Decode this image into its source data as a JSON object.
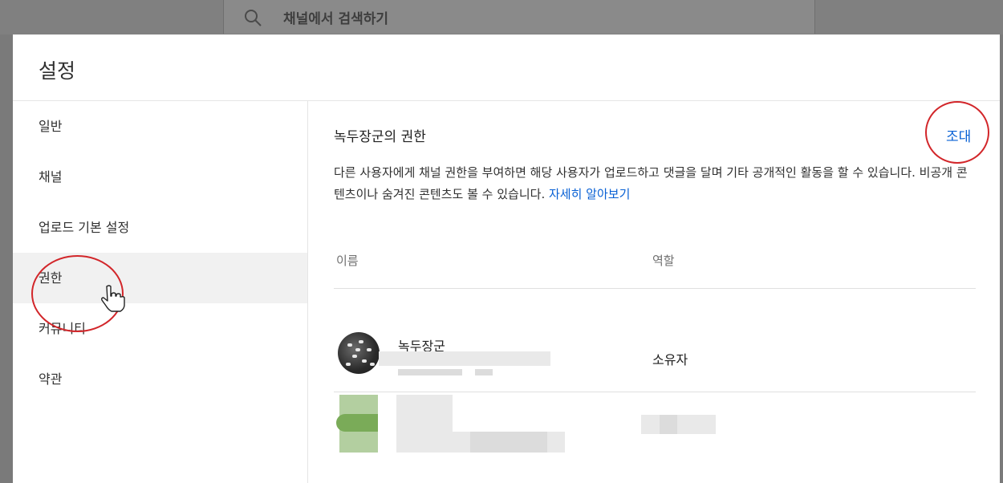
{
  "background": {
    "search_placeholder": "채널에서 검색하기"
  },
  "dialog": {
    "title": "설정"
  },
  "nav": {
    "items": [
      {
        "label": "일반"
      },
      {
        "label": "채널"
      },
      {
        "label": "업로드 기본 설정"
      },
      {
        "label": "권한",
        "active": true
      },
      {
        "label": "커뮤니티"
      },
      {
        "label": "약관"
      }
    ]
  },
  "permissions": {
    "title": "녹두장군의 권한",
    "invite_label": "조대",
    "description": "다른 사용자에게 채널 권한을 부여하면 해당 사용자가 업로드하고 댓글을 달며 기타 공개적인 활동을 할 수 있습니다. 비공개 콘텐츠이나 숨겨진 콘텐츠도 볼 수 있습니다.",
    "learn_more": "자세히 알아보기",
    "columns": {
      "name": "이름",
      "role": "역할"
    },
    "rows": [
      {
        "name": "녹두장군",
        "role": "소유자"
      }
    ]
  },
  "colors": {
    "accent": "#065fd4",
    "annotation": "#d2262a",
    "active_nav": "#f1f1f1"
  }
}
